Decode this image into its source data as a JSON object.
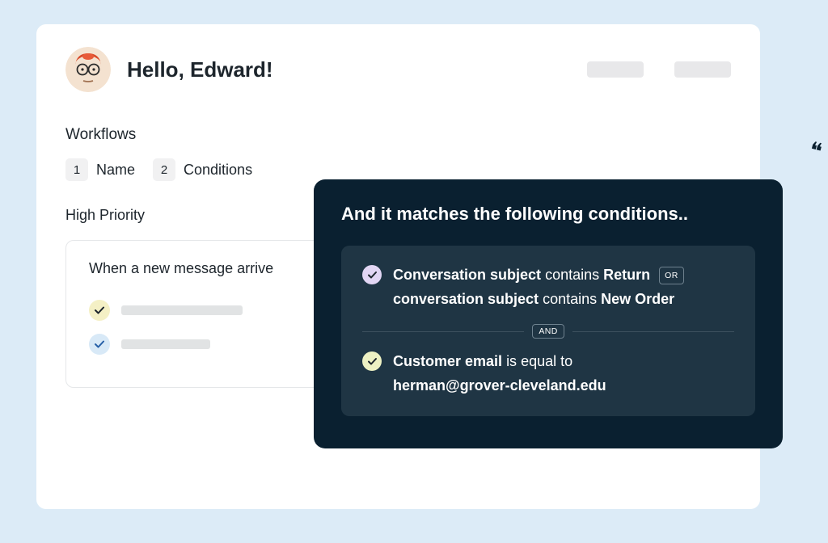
{
  "greeting": "Hello, Edward!",
  "workflows_label": "Workflows",
  "steps": [
    {
      "num": "1",
      "label": "Name"
    },
    {
      "num": "2",
      "label": "Conditions"
    }
  ],
  "subsection": "High Priority",
  "trigger_title": "When a new message arrive",
  "conditions": {
    "title": "And it matches the following conditions..",
    "rule1": {
      "field1": "Conversation subject",
      "op1": "contains",
      "val1": "Return",
      "or": "OR",
      "field2": "conversation subject",
      "op2": "contains",
      "val2": "New Order"
    },
    "and_label": "AND",
    "rule2": {
      "field": "Customer email",
      "op": "is equal to",
      "val": "herman@grover-cleveland.edu"
    }
  }
}
